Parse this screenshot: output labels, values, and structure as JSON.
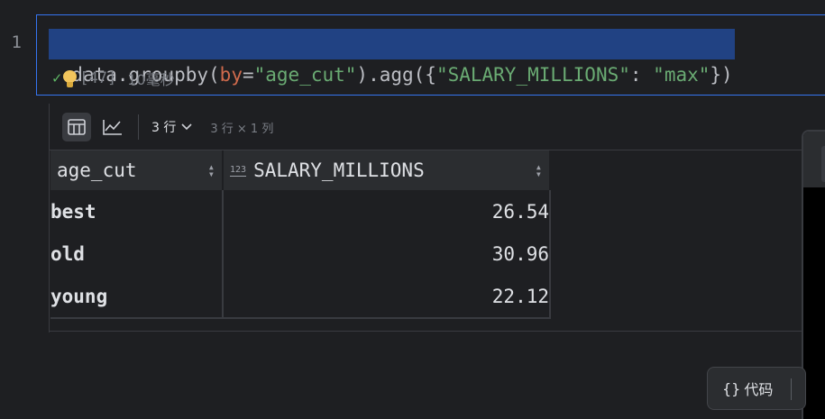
{
  "editor": {
    "line_number": "1",
    "code_tokens": [
      {
        "text": "data.groupby(",
        "kind": "plain"
      },
      {
        "text": "by",
        "kind": "kw"
      },
      {
        "text": "=",
        "kind": "plain"
      },
      {
        "text": "\"age_cut\"",
        "kind": "str"
      },
      {
        "text": ").agg({",
        "kind": "plain"
      },
      {
        "text": "\"SALARY_MILLIONS\"",
        "kind": "str"
      },
      {
        "text": ": ",
        "kind": "plain"
      },
      {
        "text": "\"max\"",
        "kind": "str"
      },
      {
        "text": "})",
        "kind": "plain"
      }
    ],
    "status": {
      "check_icon": "checkmark-icon",
      "bulb_icon": "lightbulb-icon",
      "execution_count": "[47]",
      "duration": "10毫秒"
    }
  },
  "output": {
    "toolbar": {
      "table_view_icon": "table-icon",
      "chart_view_icon": "line-chart-icon",
      "rows_label": "3 行",
      "dimensions": "3 行 × 1 列"
    },
    "table": {
      "columns": [
        {
          "name": "age_cut"
        },
        {
          "name": "SALARY_MILLIONS",
          "type_badge": "123"
        }
      ],
      "rows": [
        {
          "age_cut": "best",
          "salary": "26.54"
        },
        {
          "age_cut": "old",
          "salary": "30.96"
        },
        {
          "age_cut": "young",
          "salary": "22.12"
        }
      ]
    }
  },
  "footer": {
    "code_button_icon": "{}",
    "code_button_label": "代码"
  },
  "colors": {
    "background": "#1e1f22",
    "selection": "#214283",
    "focus_border": "#3574f0",
    "keyword": "#cf6a4c",
    "string": "#6aab73"
  }
}
